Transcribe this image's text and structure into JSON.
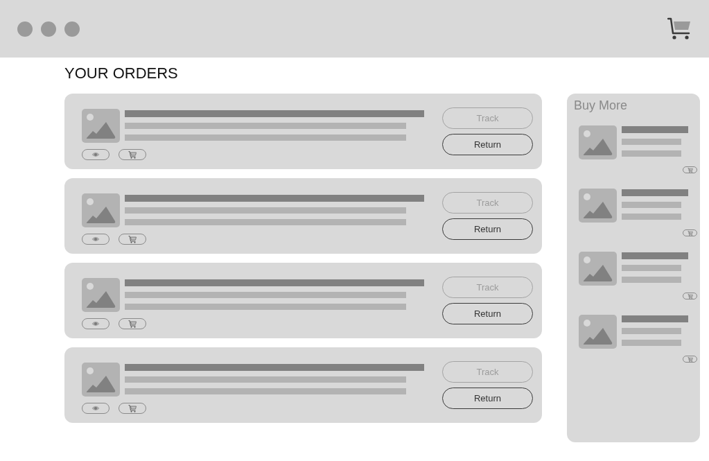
{
  "page_title": "YOUR ORDERS",
  "orders": [
    {
      "actions": [
        {
          "label": "Track",
          "disabled": true
        },
        {
          "label": "Return",
          "disabled": false
        }
      ]
    },
    {
      "actions": [
        {
          "label": "Track",
          "disabled": true
        },
        {
          "label": "Return",
          "disabled": false
        }
      ]
    },
    {
      "actions": [
        {
          "label": "Track",
          "disabled": true
        },
        {
          "label": "Return",
          "disabled": false
        }
      ]
    },
    {
      "actions": [
        {
          "label": "Track",
          "disabled": true
        },
        {
          "label": "Return",
          "disabled": false
        }
      ]
    }
  ],
  "sidebar": {
    "title": "Buy More",
    "items": [
      {
        "kind": "product"
      },
      {
        "kind": "product"
      },
      {
        "kind": "product"
      },
      {
        "kind": "product"
      }
    ]
  }
}
